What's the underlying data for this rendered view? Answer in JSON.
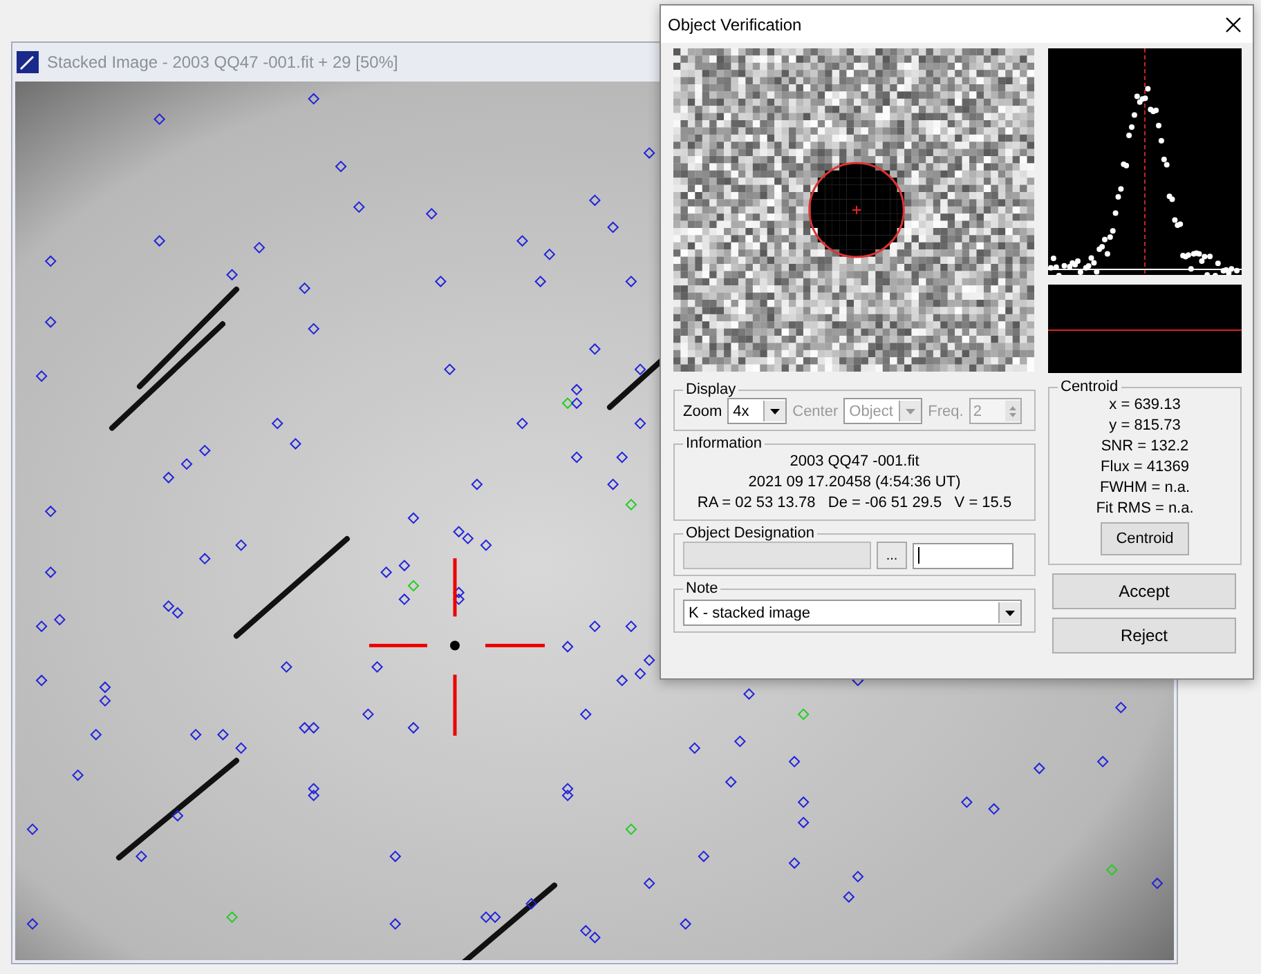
{
  "main_window": {
    "title": "Stacked Image - 2003 QQ47 -001.fit + 29 [50%]"
  },
  "dialog": {
    "title": "Object Verification",
    "display": {
      "label": "Display",
      "zoom_label": "Zoom",
      "zoom_value": "4x",
      "center_label": "Center",
      "center_value": "Object",
      "center_disabled": true,
      "freq_label": "Freq.",
      "freq_value": "2",
      "freq_disabled": true
    },
    "information": {
      "label": "Information",
      "lines": [
        "2003 QQ47 -001.fit",
        "2021 09 17.20458 (4:54:36 UT)",
        "RA = 02 53 13.78   De = -06 51 29.5   V = 15.5"
      ]
    },
    "designation": {
      "label": "Object Designation",
      "browse": "..."
    },
    "note": {
      "label": "Note",
      "value": "K - stacked image"
    },
    "centroid": {
      "label": "Centroid",
      "lines": [
        "x = 639.13",
        "y = 815.73",
        "SNR = 132.2",
        "Flux = 41369",
        "FWHM = n.a.",
        "Fit RMS = n.a."
      ],
      "button": "Centroid"
    },
    "buttons": [
      "Accept",
      "Reject"
    ]
  }
}
